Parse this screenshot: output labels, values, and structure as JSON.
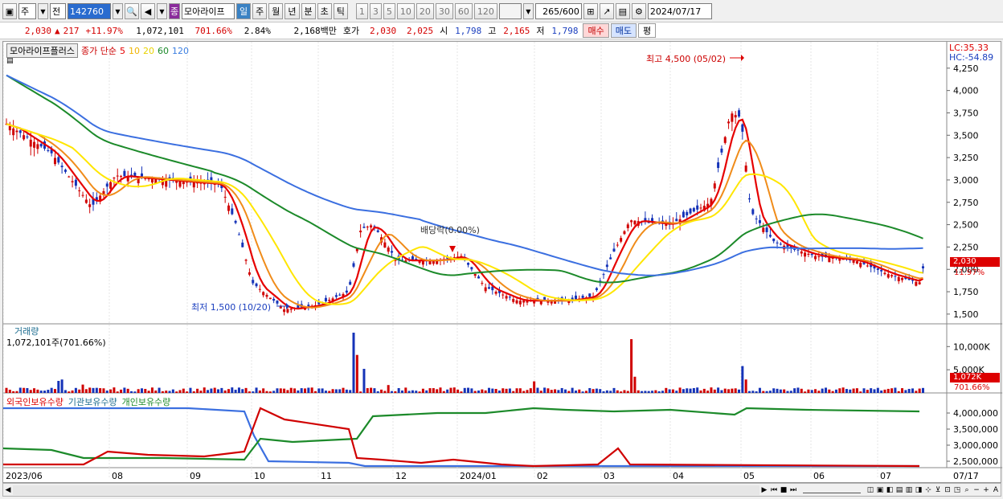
{
  "toolbar": {
    "market": "주",
    "period_btn": "전",
    "code": "142760",
    "name_tag": "종",
    "name": "모아라이프",
    "tf": [
      "일",
      "주",
      "월",
      "년",
      "분",
      "초",
      "틱"
    ],
    "tf_active": "일",
    "nums": [
      "1",
      "3",
      "5",
      "10",
      "20",
      "30",
      "60",
      "120"
    ],
    "count": "265",
    "count_max": "/600",
    "date": "2024/07/17"
  },
  "quote": {
    "price": "2,030",
    "arrow": "▲",
    "change": "217",
    "pct": "+11.97%",
    "volume": "1,072,101",
    "vol_ratio": "701.66%",
    "turnover": "2.84%",
    "amount": "2,168백만",
    "hoga_label": "호가",
    "ask": "2,030",
    "bid": "2,025",
    "open_label": "시",
    "open": "1,798",
    "high_label": "고",
    "high": "2,165",
    "low_label": "저",
    "low": "1,798",
    "buy": "매수",
    "sell": "매도",
    "pyeong": "평"
  },
  "chart": {
    "legend_name": "모아라이프플러스",
    "legend_ma_label": "종가 단순",
    "ma_periods": [
      {
        "p": "5",
        "color": "#e60000"
      },
      {
        "p": "10",
        "color": "#f7c600"
      },
      {
        "p": "20",
        "color": "#ffe600"
      },
      {
        "p": "60",
        "color": "#1c8a2a"
      },
      {
        "p": "120",
        "color": "#3b7ee0"
      }
    ],
    "lc": "LC:35.33",
    "hc": "HC:-54.89",
    "y_ticks": [
      "4,250",
      "4,000",
      "3,750",
      "3,500",
      "3,250",
      "3,000",
      "2,750",
      "2,500",
      "2,250",
      "2,000",
      "1,750",
      "1,500"
    ],
    "cur_price": "2,030",
    "cur_pct": "11.97%",
    "high_note": "최고 4,500 (05/02)",
    "low_note": "최저 1,500 (10/20)",
    "div_note": "배당락(0.00%)",
    "vol_title": "거래량",
    "vol_sub": "1,072,101주(701.66%)",
    "vol_ticks": [
      "10,000K",
      "5,000K"
    ],
    "vol_cur": "1,072K",
    "vol_pct": "701.66%",
    "own_labels": [
      "외국인보유수량",
      "기관보유수량",
      "개인보유수량"
    ],
    "own_ticks": [
      "4,000,000",
      "3,500,000",
      "3,000,000",
      "2,500,000"
    ],
    "x_ticks": [
      "2023/06",
      "08",
      "09",
      "10",
      "11",
      "12",
      "2024/01",
      "02",
      "03",
      "04",
      "05",
      "06",
      "07",
      "07/17"
    ]
  }
}
